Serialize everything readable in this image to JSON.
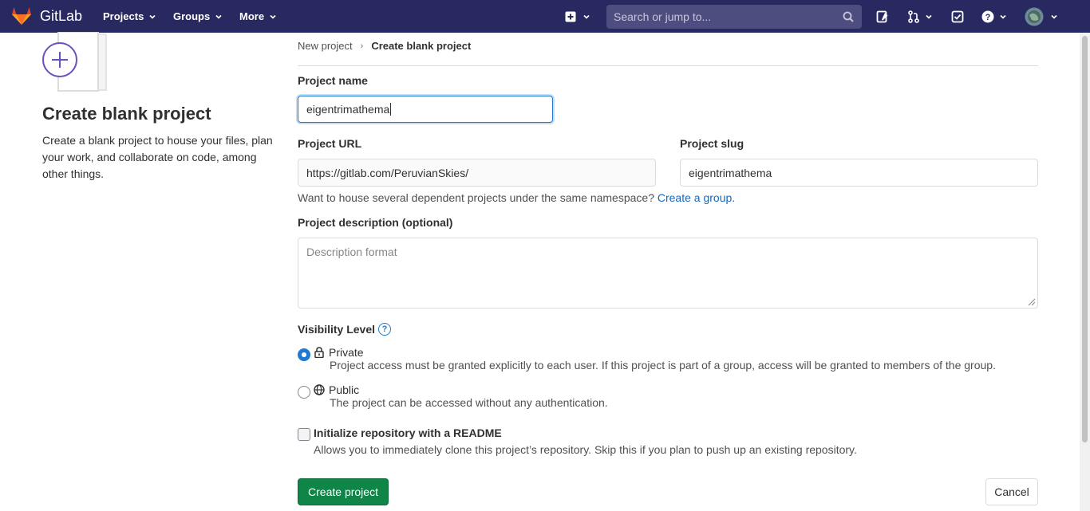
{
  "navbar": {
    "logo_text": "GitLab",
    "menus": [
      {
        "label": "Projects"
      },
      {
        "label": "Groups"
      },
      {
        "label": "More"
      }
    ],
    "search_placeholder": "Search or jump to...",
    "icons": [
      "plus-square-icon",
      "search-icon",
      "issues-icon",
      "merge-request-icon",
      "todo-icon",
      "help-icon",
      "avatar"
    ],
    "background_color": "#292961"
  },
  "sidebar": {
    "title": "Create blank project",
    "description": "Create a blank project to house your files, plan your work, and collaborate on code, among other things."
  },
  "breadcrumb": {
    "parent": "New project",
    "current": "Create blank project"
  },
  "form": {
    "project_name_label": "Project name",
    "project_name_value": "eigentrimathema",
    "project_url_label": "Project URL",
    "project_url_value": "https://gitlab.com/PeruvianSkies/",
    "project_slug_label": "Project slug",
    "project_slug_value": "eigentrimathema",
    "namespace_help": "Want to house several dependent projects under the same namespace?",
    "create_group_link": "Create a group.",
    "description_label": "Project description (optional)",
    "description_placeholder": "Description format",
    "visibility_label": "Visibility Level",
    "visibility_options": [
      {
        "title": "Private",
        "description": "Project access must be granted explicitly to each user. If this project is part of a group, access will be granted to members of the group.",
        "selected": true,
        "icon": "lock-icon"
      },
      {
        "title": "Public",
        "description": "The project can be accessed without any authentication.",
        "selected": false,
        "icon": "globe-icon"
      }
    ],
    "readme_label": "Initialize repository with a README",
    "readme_description": "Allows you to immediately clone this project’s repository. Skip this if you plan to push up an existing repository.",
    "readme_checked": false,
    "create_button": "Create project",
    "cancel_button": "Cancel",
    "primary_color": "#108548",
    "link_color": "#1068bf"
  }
}
